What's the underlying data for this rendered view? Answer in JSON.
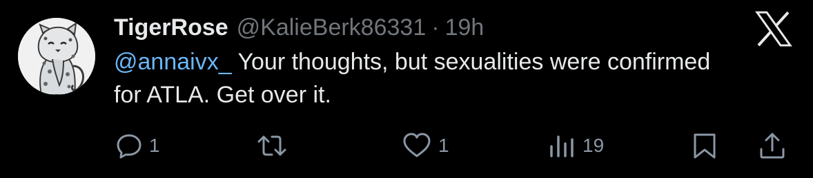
{
  "tweet": {
    "display_name": "TigerRose",
    "handle": "@KalieBerk86331",
    "separator": "·",
    "time": "19h",
    "mention": "@annaivx_",
    "text": " Your thoughts, but sexualities were confirmed for ATLA. Get over it."
  },
  "actions": {
    "replies": "1",
    "reposts": "",
    "likes": "1",
    "views": "19"
  },
  "icons": {
    "avatar": "snow-leopard-avatar",
    "logo": "x-logo-icon",
    "reply": "reply-icon",
    "repost": "repost-icon",
    "like": "heart-icon",
    "views": "views-icon",
    "bookmark": "bookmark-icon",
    "share": "share-icon"
  },
  "colors": {
    "background": "#000000",
    "primary_text": "#e7e9ea",
    "secondary_text": "#71767b",
    "mention": "#6ab6f5",
    "icon": "#8b98a5"
  }
}
